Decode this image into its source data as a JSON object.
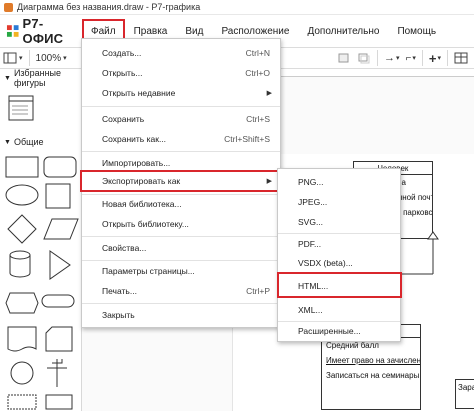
{
  "window": {
    "title": "Диаграмма без названия.draw - Р7-графика"
  },
  "brand": {
    "name": "Р7-ОФИС"
  },
  "menu": {
    "items": [
      "Файл",
      "Правка",
      "Вид",
      "Расположение",
      "Дополнительно",
      "Помощь"
    ]
  },
  "toolbar": {
    "zoom": "100%"
  },
  "sidebar": {
    "favorites": "Избранные фигуры",
    "general": "Общие"
  },
  "file_menu": {
    "items": [
      {
        "label": "Создать...",
        "shortcut": "Ctrl+N"
      },
      {
        "label": "Открыть...",
        "shortcut": "Ctrl+O"
      },
      {
        "label": "Открыть недавние",
        "shortcut": ""
      },
      {
        "label": "Сохранить",
        "shortcut": "Ctrl+S"
      },
      {
        "label": "Сохранить как...",
        "shortcut": "Ctrl+Shift+S"
      },
      {
        "label": "Импортировать...",
        "shortcut": ""
      },
      {
        "label": "Экспортировать как",
        "shortcut": ""
      },
      {
        "label": "Новая библиотека...",
        "shortcut": ""
      },
      {
        "label": "Открыть библиотеку...",
        "shortcut": ""
      },
      {
        "label": "Свойства...",
        "shortcut": ""
      },
      {
        "label": "Параметры страницы...",
        "shortcut": ""
      },
      {
        "label": "Печать...",
        "shortcut": "Ctrl+P"
      },
      {
        "label": "Закрыть",
        "shortcut": ""
      }
    ]
  },
  "export_menu": {
    "items": [
      "PNG...",
      "JPEG...",
      "SVG...",
      "PDF...",
      "VSDX (beta)...",
      "HTML...",
      "XML...",
      "Расширенные..."
    ]
  },
  "canvas": {
    "class_person": {
      "title": "Человек",
      "rows": [
        "ер телефона",
        "ес электронной почт",
        "образтение парковс"
      ]
    },
    "class_student": {
      "rows": [
        "Средний балл",
        "Имеет право на зачислени",
        "Записаться на семинары"
      ]
    },
    "class_right": {
      "label": "Зара"
    }
  }
}
